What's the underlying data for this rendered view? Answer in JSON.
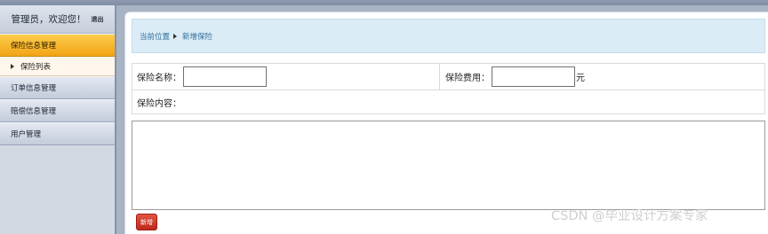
{
  "sidebar": {
    "welcome": "管理员，欢迎您！",
    "logout": "退出",
    "menu": {
      "insurance": "保险信息管理",
      "insurance_list": "保险列表",
      "orders": "订单信息管理",
      "claims": "赔偿信息管理",
      "users": "用户管理"
    }
  },
  "breadcrumb": {
    "location": "当前位置",
    "current": "新增保险"
  },
  "form": {
    "name_label": "保险名称：",
    "name_value": "",
    "fee_label": "保险费用：",
    "fee_value": "",
    "fee_unit": "元",
    "content_label": "保险内容：",
    "content_value": "",
    "submit_label": "新增"
  },
  "watermark": "CSDN @毕业设计方案专家"
}
